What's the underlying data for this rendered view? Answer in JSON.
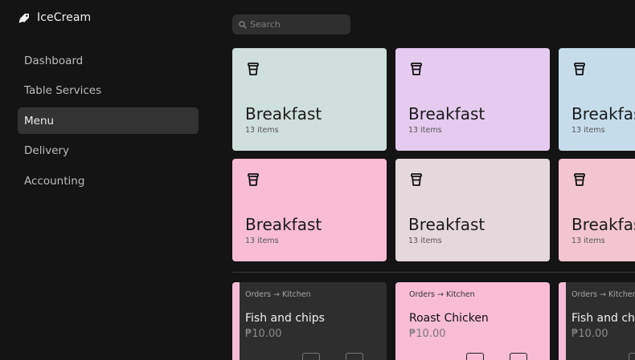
{
  "app": {
    "name": "IceCream",
    "logo_icon": "ice-cream-tag-icon"
  },
  "sidebar": {
    "items": [
      {
        "label": "Dashboard",
        "active": false
      },
      {
        "label": "Table Services",
        "active": false
      },
      {
        "label": "Menu",
        "active": true
      },
      {
        "label": "Delivery",
        "active": false
      },
      {
        "label": "Accounting",
        "active": false
      }
    ]
  },
  "search": {
    "placeholder": "Search",
    "value": "",
    "icon": "search-icon"
  },
  "categories": [
    {
      "title": "Breakfast",
      "count": "13 items",
      "color": "#cfdfdb",
      "icon": "coffee-cup-icon"
    },
    {
      "title": "Breakfast",
      "count": "13 items",
      "color": "#e4cbef",
      "icon": "coffee-cup-icon"
    },
    {
      "title": "Breakfast",
      "count": "13 items",
      "color": "#c5ddeb",
      "icon": "coffee-cup-icon"
    },
    {
      "title": "Breakfast",
      "count": "13 items",
      "color": "#f8bcd5",
      "icon": "coffee-cup-icon"
    },
    {
      "title": "Breakfast",
      "count": "13 items",
      "color": "#e5d8dc",
      "icon": "coffee-cup-icon"
    },
    {
      "title": "Breakfast",
      "count": "13 items",
      "color": "#f3c5d1",
      "icon": "coffee-cup-icon"
    }
  ],
  "orders": [
    {
      "route": "Orders → Kitchen",
      "name": "Fish and chips",
      "price": "₱10.00",
      "style": "dark"
    },
    {
      "route": "Orders → Kitchen",
      "name": "Roast Chicken",
      "price": "₱10.00",
      "style": "pink"
    },
    {
      "route": "Orders → Kitchen",
      "name": "Fish and chips",
      "price": "₱10.00",
      "style": "dark"
    }
  ]
}
